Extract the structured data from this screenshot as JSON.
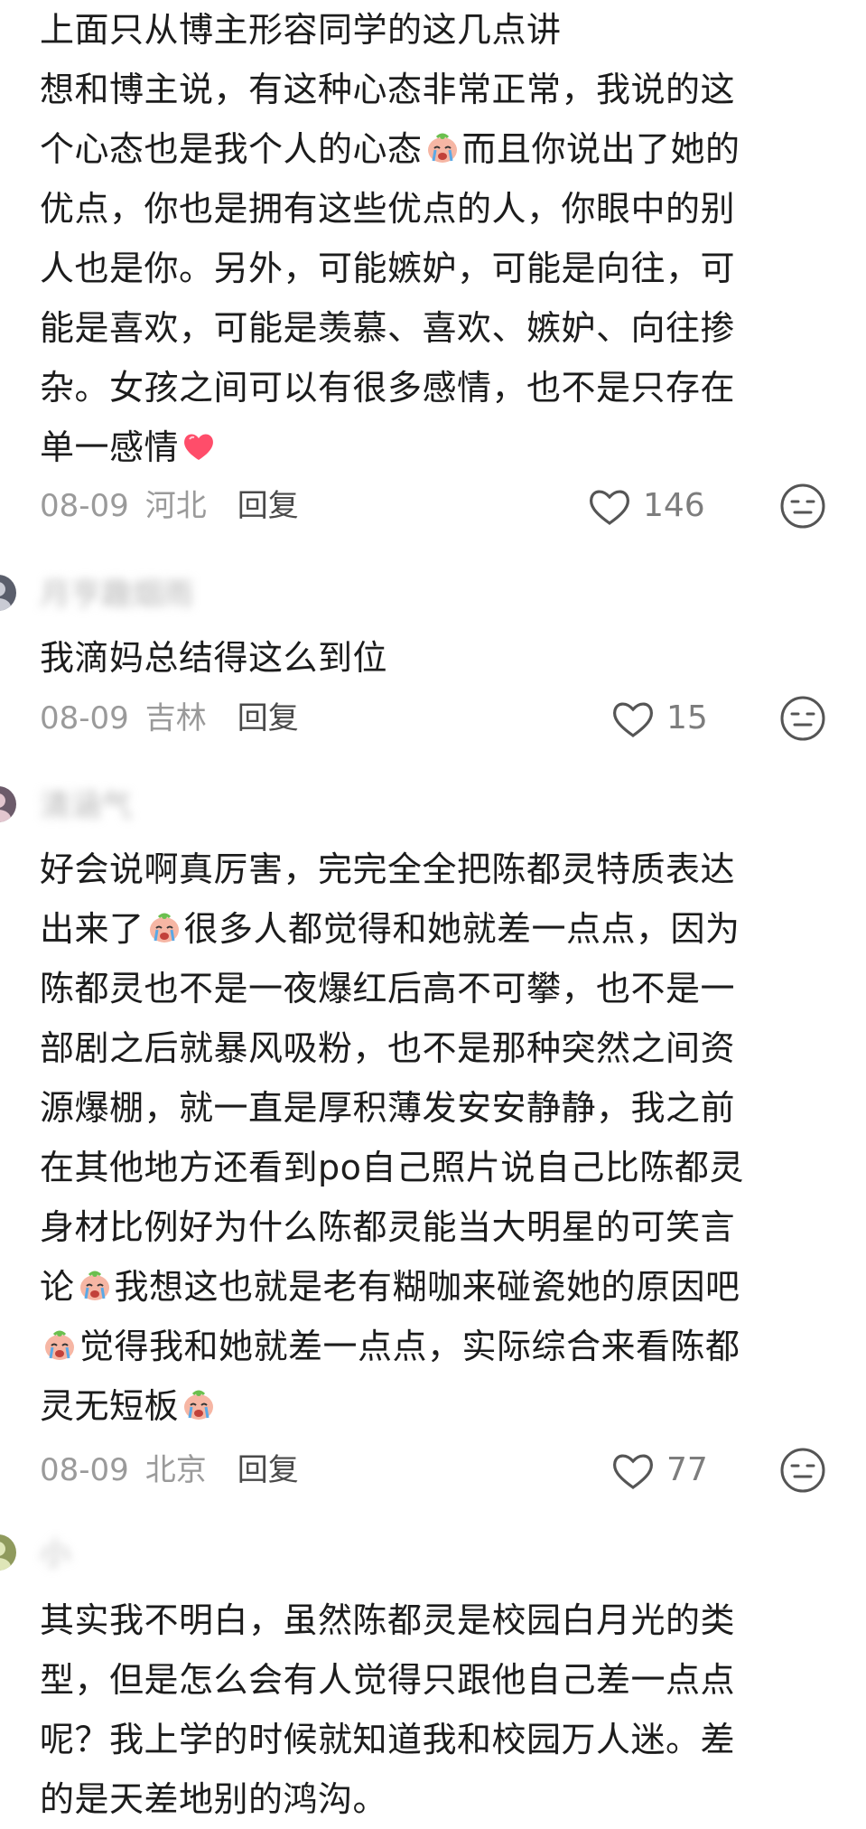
{
  "comments": [
    {
      "username": "",
      "lines": [
        "上面只从博主形容同学的这几点讲",
        "想和博主说，有这种心态非常正常，我说的这",
        [
          "个心态也是我个人的心态",
          "而且你说出了她的"
        ],
        "优点，你也是拥有这些优点的人，你眼中的别",
        "人也是你。另外，可能嫉妒，可能是向往，可",
        "能是喜欢，可能是羡慕、喜欢、嫉妒、向往掺",
        "杂。女孩之间可以有很多感情，也不是只存在",
        [
          "单一感情",
          ""
        ]
      ],
      "date": "08-09",
      "region": "河北",
      "reply_label": "回复",
      "likes": "146",
      "emoji_names": [
        "crying-face-emoji",
        "red-heart-emoji"
      ]
    },
    {
      "username": "月亨趣烟雨",
      "lines": [
        "我滴妈总结得这么到位"
      ],
      "date": "08-09",
      "region": "吉林",
      "reply_label": "回复",
      "likes": "15"
    },
    {
      "username": "清涵气",
      "lines": [
        "好会说啊真厉害，完完全全把陈都灵特质表达",
        [
          "出来了",
          "很多人都觉得和她就差一点点，因为"
        ],
        "陈都灵也不是一夜爆红后高不可攀，也不是一",
        "部剧之后就暴风吸粉，也不是那种突然之间资",
        "源爆棚，就一直是厚积薄发安安静静，我之前",
        "在其他地方还看到po自己照片说自己比陈都灵",
        "身材比例好为什么陈都灵能当大明星的可笑言",
        [
          "论",
          "我想这也就是老有糊咖来碰瓷她的原因吧"
        ],
        [
          "",
          "觉得我和她就差一点点，实际综合来看陈都"
        ],
        [
          "灵无短板",
          ""
        ]
      ],
      "date": "08-09",
      "region": "北京",
      "reply_label": "回复",
      "likes": "77"
    },
    {
      "username": "小",
      "lines": [
        "其实我不明白，虽然陈都灵是校园白月光的类",
        "型，但是怎么会有人觉得只跟他自己差一点点",
        "呢？我上学的时候就知道我和校园万人迷。差",
        "的是天差地别的鸿沟。"
      ]
    }
  ],
  "colors": {
    "text": "#1c1c1c",
    "meta": "#9a9a9a",
    "icon": "#555555",
    "heart": "#ff4d6a"
  }
}
